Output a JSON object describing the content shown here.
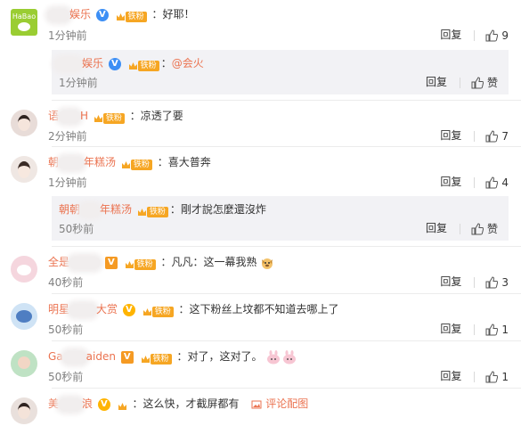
{
  "comments": [
    {
      "user": "娱乐",
      "badge": "V",
      "text": "：好耶！",
      "time": "1分钟前",
      "reply": "回复",
      "likes": "9",
      "sub": {
        "user": "娱乐",
        "text_prefix": "：",
        "mention": "@会火",
        "time": "1分钟前",
        "reply": "回复",
        "like_label": "赞"
      }
    },
    {
      "user": "语",
      "user_tail": "H",
      "text": "：凉透了要",
      "time": "2分钟前",
      "reply": "回复",
      "likes": "7"
    },
    {
      "user": "朝",
      "user_tail": "年糕汤",
      "text": "：喜大普奔",
      "time": "1分钟前",
      "reply": "回复",
      "likes": "4",
      "sub": {
        "user": "朝朝",
        "user_tail": "年糕汤",
        "text": "：剛才說怎麼還沒炸",
        "time": "50秒前",
        "reply": "回复",
        "like_label": "赞"
      }
    },
    {
      "user": "全是",
      "text": "：凡凡：这一幕我熟",
      "time": "40秒前",
      "reply": "回复",
      "likes": "3"
    },
    {
      "user": "明星",
      "user_tail": "大赏",
      "text": "：这下粉丝上坟都不知道去哪上了",
      "time": "50秒前",
      "reply": "回复",
      "likes": "1"
    },
    {
      "user": "Ga",
      "user_tail": "aiden",
      "text": "：对了，这对了。",
      "time": "50秒前",
      "reply": "回复",
      "likes": "1"
    },
    {
      "user": "美",
      "user_tail": "浪",
      "text": "：这么快，才截屏都有",
      "pic_link": "评论配图"
    }
  ],
  "avatars": {
    "first_text": "HaBao"
  }
}
